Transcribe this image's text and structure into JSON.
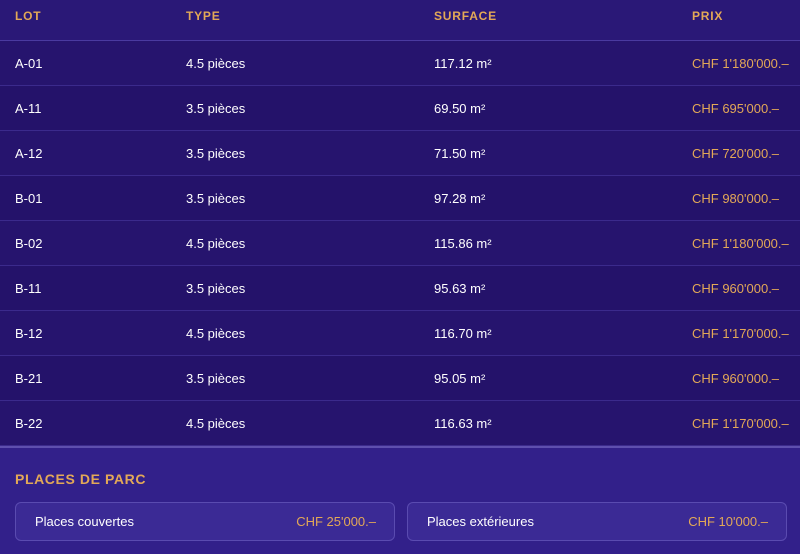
{
  "table": {
    "headers": {
      "lot": "LOT",
      "type": "TYPE",
      "surface": "SURFACE",
      "prix": "PRIX"
    },
    "rows": [
      {
        "lot": "A-01",
        "type": "4.5 pièces",
        "surface": "117.12 m²",
        "prix": "CHF 1'180'000.–"
      },
      {
        "lot": "A-11",
        "type": "3.5 pièces",
        "surface": "69.50 m²",
        "prix": "CHF 695'000.–"
      },
      {
        "lot": "A-12",
        "type": "3.5 pièces",
        "surface": "71.50 m²",
        "prix": "CHF 720'000.–"
      },
      {
        "lot": "B-01",
        "type": "3.5 pièces",
        "surface": "97.28 m²",
        "prix": "CHF 980'000.–"
      },
      {
        "lot": "B-02",
        "type": "4.5 pièces",
        "surface": "115.86 m²",
        "prix": "CHF 1'180'000.–"
      },
      {
        "lot": "B-11",
        "type": "3.5 pièces",
        "surface": "95.63 m²",
        "prix": "CHF 960'000.–"
      },
      {
        "lot": "B-12",
        "type": "4.5 pièces",
        "surface": "116.70 m²",
        "prix": "CHF 1'170'000.–"
      },
      {
        "lot": "B-21",
        "type": "3.5 pièces",
        "surface": "95.05 m²",
        "prix": "CHF 960'000.–"
      },
      {
        "lot": "B-22",
        "type": "4.5 pièces",
        "surface": "116.63 m²",
        "prix": "CHF 1'170'000.–"
      }
    ]
  },
  "parking": {
    "title": "PLACES DE PARC",
    "items": [
      {
        "label": "Places couvertes",
        "price": "CHF 25'000.–"
      },
      {
        "label": "Places extérieures",
        "price": "CHF 10'000.–"
      }
    ]
  },
  "colors": {
    "accent": "#e3a857",
    "background": "#26146e",
    "panel": "#32208a"
  }
}
